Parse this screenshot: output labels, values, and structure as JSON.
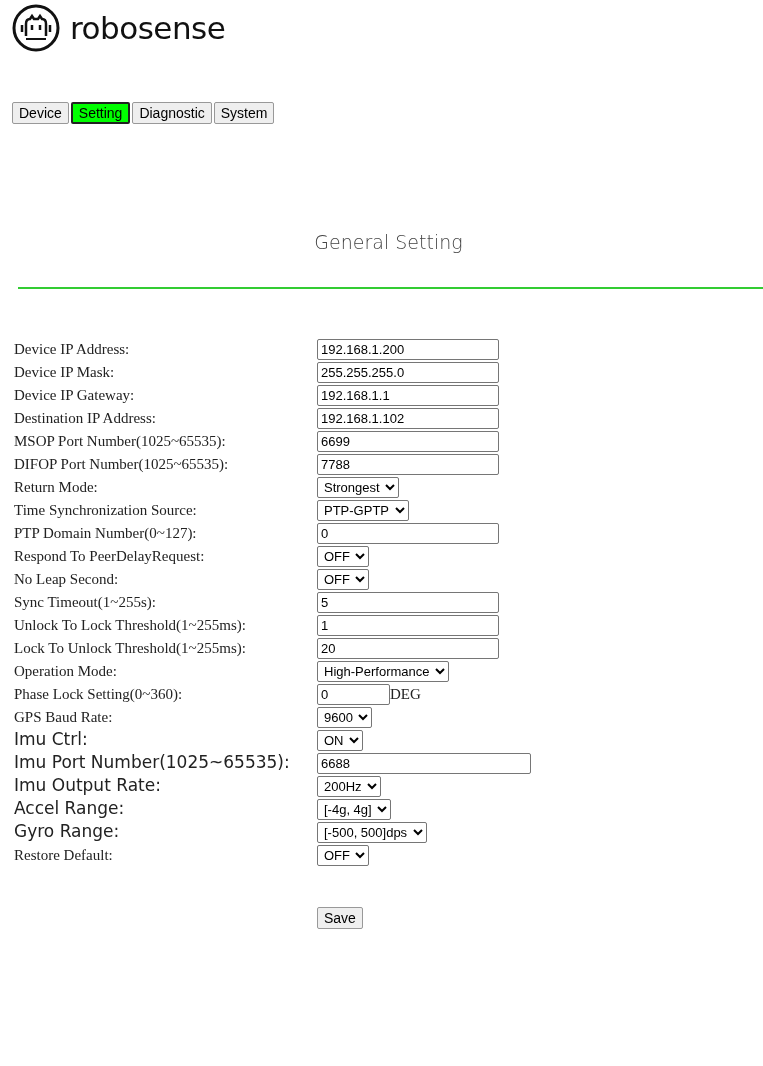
{
  "logo": {
    "wordmark": "robosense"
  },
  "tabs": [
    {
      "label": "Device",
      "selected": false
    },
    {
      "label": "Setting",
      "selected": true
    },
    {
      "label": "Diagnostic",
      "selected": false
    },
    {
      "label": "System",
      "selected": false
    }
  ],
  "title": "General Setting",
  "sections": [
    {
      "kind": "general",
      "fields": [
        {
          "label": "Device IP Address:",
          "kind": "text",
          "value": "192.168.1.200"
        },
        {
          "label": "Device IP Mask:",
          "kind": "text",
          "value": "255.255.255.0"
        },
        {
          "label": "Device IP Gateway:",
          "kind": "text",
          "value": "192.168.1.1"
        },
        {
          "label": "Destination IP Address:",
          "kind": "text",
          "value": "192.168.1.102"
        },
        {
          "label": "MSOP Port Number(1025~65535):",
          "kind": "text",
          "value": "6699"
        },
        {
          "label": "DIFOP Port Number(1025~65535):",
          "kind": "text",
          "value": "7788"
        },
        {
          "label": "Return Mode:",
          "kind": "select",
          "value": "Strongest"
        },
        {
          "label": "Time Synchronization Source:",
          "kind": "select",
          "value": "PTP-GPTP"
        },
        {
          "label": "PTP Domain Number(0~127):",
          "kind": "text",
          "value": "0"
        },
        {
          "label": "Respond To PeerDelayRequest:",
          "kind": "select",
          "value": "OFF"
        },
        {
          "label": "No Leap Second:",
          "kind": "select",
          "value": "OFF"
        },
        {
          "label": "Sync Timeout(1~255s):",
          "kind": "text",
          "value": "5"
        },
        {
          "label": "Unlock To Lock Threshold(1~255ms):",
          "kind": "text",
          "value": "1"
        },
        {
          "label": "Lock To Unlock Threshold(1~255ms):",
          "kind": "text",
          "value": "20"
        },
        {
          "label": "Operation Mode:",
          "kind": "select",
          "value": "High-Performance"
        },
        {
          "label": "Phase Lock Setting(0~360):",
          "kind": "unit",
          "value": "0",
          "unit": "DEG"
        },
        {
          "label": "GPS Baud Rate:",
          "kind": "select",
          "value": "9600"
        }
      ]
    },
    {
      "kind": "imu",
      "fields": [
        {
          "label": "Imu Ctrl:",
          "kind": "select",
          "value": "ON"
        },
        {
          "label": "Imu Port Number(1025~65535):",
          "kind": "text",
          "value": "6688"
        },
        {
          "label": "Imu Output Rate:",
          "kind": "select",
          "value": "200Hz"
        },
        {
          "label": "Accel Range:",
          "kind": "select",
          "value": "[-4g, 4g]"
        },
        {
          "label": "Gyro Range:",
          "kind": "select",
          "value": "[-500, 500]dps"
        }
      ]
    },
    {
      "kind": "general",
      "fields": [
        {
          "label": "Restore Default:",
          "kind": "select",
          "value": "OFF"
        }
      ]
    }
  ],
  "save_button": "Save"
}
